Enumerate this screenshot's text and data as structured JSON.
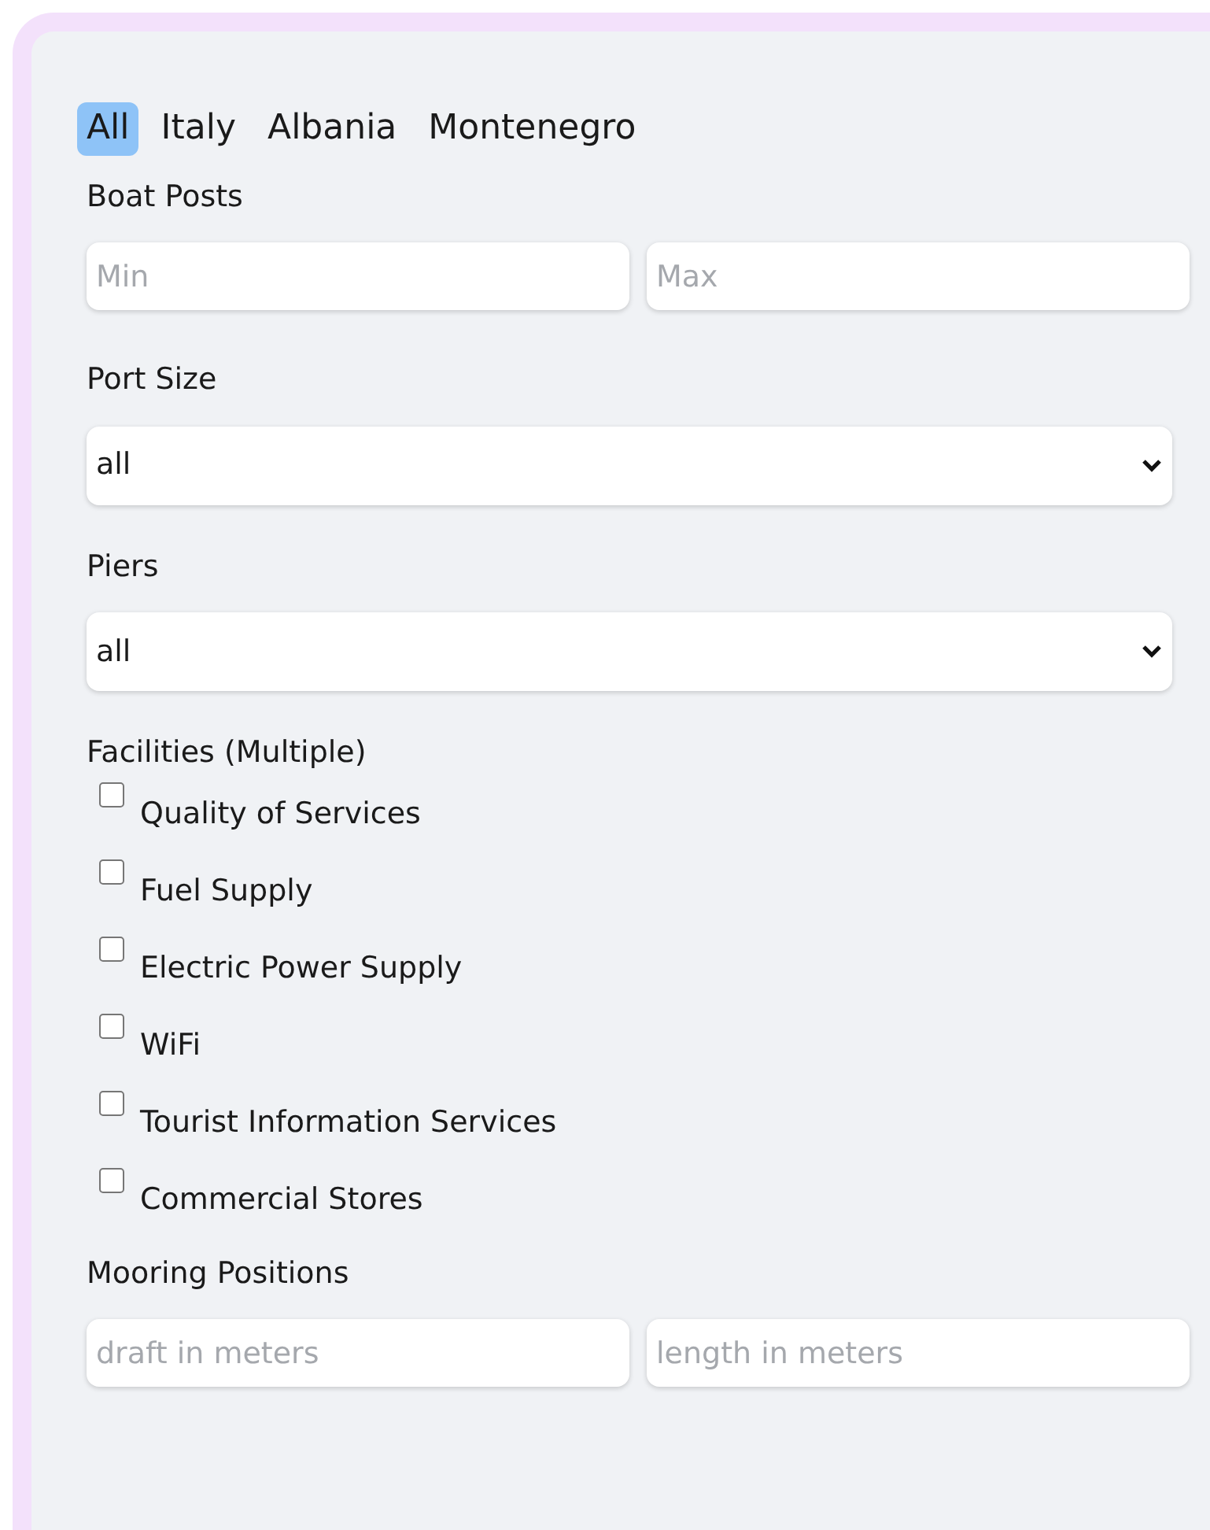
{
  "tabs": [
    {
      "label": "All",
      "selected": true
    },
    {
      "label": "Italy",
      "selected": false
    },
    {
      "label": "Albania",
      "selected": false
    },
    {
      "label": "Montenegro",
      "selected": false
    }
  ],
  "boat_posts": {
    "label": "Boat Posts",
    "min": {
      "placeholder": "Min"
    },
    "max": {
      "placeholder": "Max"
    }
  },
  "port_size": {
    "label": "Port Size",
    "value": "all"
  },
  "piers": {
    "label": "Piers",
    "value": "all"
  },
  "facilities": {
    "label": "Facilities (Multiple)",
    "items": [
      {
        "label": "Quality of Services",
        "checked": false
      },
      {
        "label": "Fuel Supply",
        "checked": false
      },
      {
        "label": "Electric Power Supply",
        "checked": false
      },
      {
        "label": "WiFi",
        "checked": false
      },
      {
        "label": "Tourist Information Services",
        "checked": false
      },
      {
        "label": "Commercial Stores",
        "checked": false
      }
    ]
  },
  "mooring_positions": {
    "label": "Mooring Positions",
    "draft": {
      "placeholder": "draft in meters"
    },
    "length": {
      "placeholder": "length in meters"
    }
  }
}
